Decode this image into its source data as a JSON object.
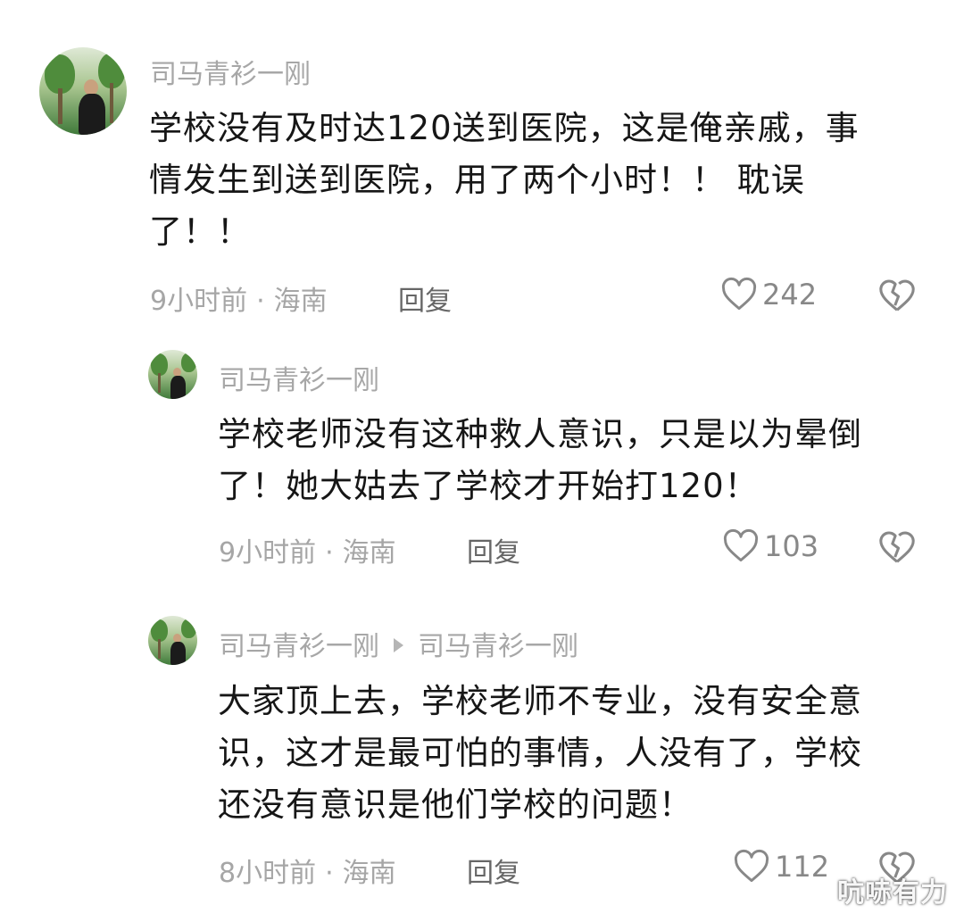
{
  "comments": [
    {
      "username": "司马青衫一刚",
      "lines": [
        "学校没有及时达120送到医院，这是俺亲戚，事",
        "情发生到送到医院，用了两个小时！！ 耽误",
        "了！！"
      ],
      "time": "9小时前",
      "location": "海南",
      "reply_label": "回复",
      "likes": "242"
    },
    {
      "username": "司马青衫一刚",
      "lines": [
        "学校老师没有这种救人意识，只是以为晕倒",
        "了！她大姑去了学校才开始打120！"
      ],
      "time": "9小时前",
      "location": "海南",
      "reply_label": "回复",
      "likes": "103"
    },
    {
      "username": "司马青衫一刚",
      "reply_to": "司马青衫一刚",
      "lines": [
        "大家顶上去，学校老师不专业，没有安全意",
        "识，这才是最可怕的事情，人没有了，学校",
        "还没有意识是他们学校的问题！"
      ],
      "time": "8小时前",
      "location": "海南",
      "reply_label": "回复",
      "likes": "112"
    }
  ],
  "meta_separator": "·",
  "icons": {
    "like": "heart-outline-icon",
    "dislike": "broken-heart-icon",
    "reply_arrow": "triangle-right-icon"
  },
  "watermark": "吭哧有力"
}
